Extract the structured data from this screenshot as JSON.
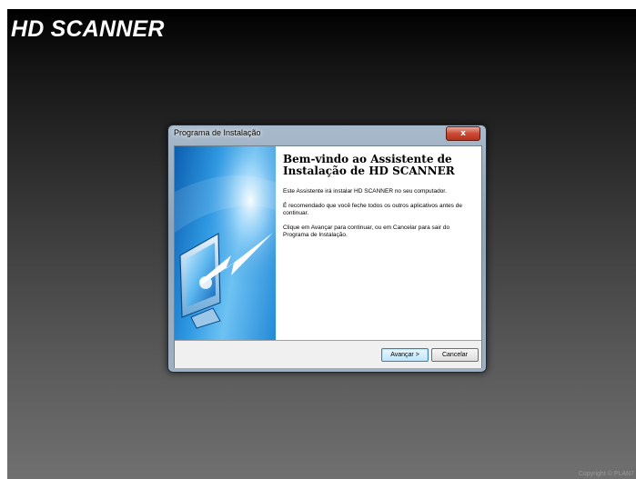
{
  "app_title": "HD SCANNER",
  "copyright": "Copyright © PLAN7",
  "window": {
    "title": "Programa de Instalação",
    "close_label": "x"
  },
  "wizard": {
    "heading": "Bem-vindo ao Assistente de Instalação de HD SCANNER",
    "paragraphs": [
      "Este Assistente irá instalar HD SCANNER no seu computador.",
      "É recomendado que você feche todos os outros aplicativos antes de continuar.",
      "Clique em Avançar para continuar, ou em Cancelar para sair do Programa de Instalação."
    ],
    "banner_icon": "monitor-with-arrow-icon"
  },
  "buttons": {
    "next": "Avançar >",
    "cancel": "Cancelar"
  }
}
